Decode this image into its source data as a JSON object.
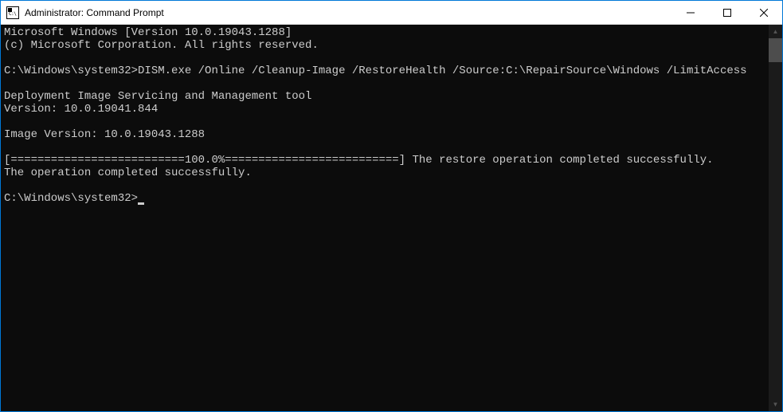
{
  "window": {
    "title": "Administrator: Command Prompt"
  },
  "console": {
    "line_banner1": "Microsoft Windows [Version 10.0.19043.1288]",
    "line_banner2": "(c) Microsoft Corporation. All rights reserved.",
    "blank": "",
    "prompt1": "C:\\Windows\\system32>",
    "command1": "DISM.exe /Online /Cleanup-Image /RestoreHealth /Source:C:\\RepairSource\\Windows /LimitAccess",
    "tool_title": "Deployment Image Servicing and Management tool",
    "tool_version": "Version: 10.0.19041.844",
    "image_version": "Image Version: 10.0.19043.1288",
    "progress_line": "[==========================100.0%==========================] The restore operation completed successfully.",
    "completed": "The operation completed successfully.",
    "prompt2": "C:\\Windows\\system32>"
  }
}
